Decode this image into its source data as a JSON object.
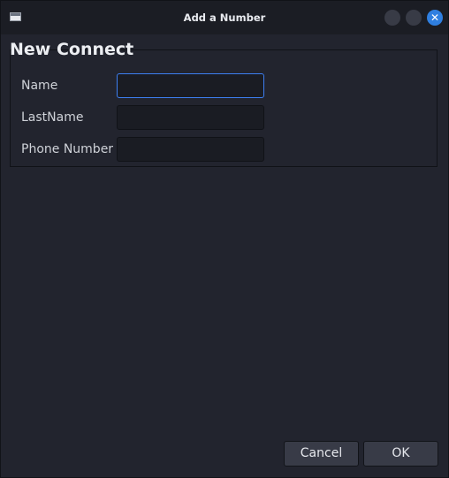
{
  "window": {
    "title": "Add a Number",
    "icon": "app-window-icon",
    "controls": {
      "minimize": "minimize-icon",
      "maximize": "maximize-icon",
      "close": "close-icon",
      "close_glyph": "✕"
    }
  },
  "form": {
    "group_title": "New Connect",
    "fields": [
      {
        "label": "Name",
        "value": "",
        "focused": true
      },
      {
        "label": "LastName",
        "value": ""
      },
      {
        "label": "Phone Number",
        "value": ""
      }
    ]
  },
  "buttons": {
    "cancel": "Cancel",
    "ok": "OK"
  },
  "colors": {
    "accent": "#3d7ff2",
    "background": "#22242e",
    "close_button": "#2f7fe0"
  }
}
